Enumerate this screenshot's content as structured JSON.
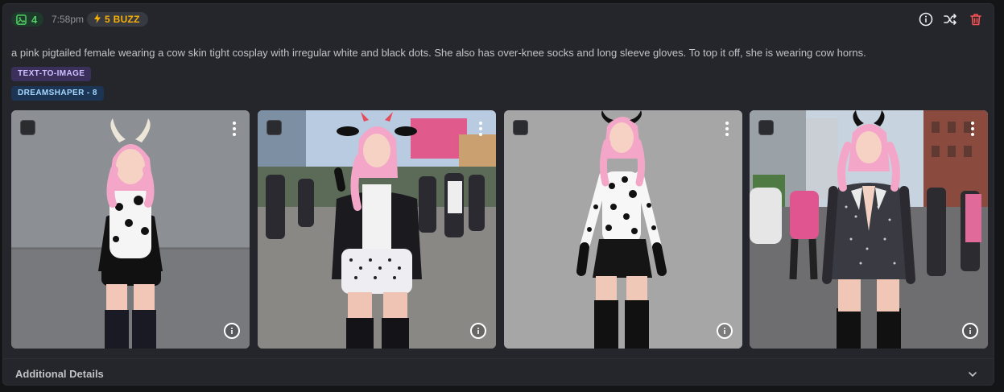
{
  "header": {
    "image_count": "4",
    "time": "7:58pm",
    "buzz": "5 BUZZ",
    "icons": [
      "image-icon",
      "bolt-icon",
      "info-circle-icon",
      "shuffle-icon",
      "trash-icon"
    ]
  },
  "prompt": "a pink pigtailed female wearing a cow skin tight cosplay with irregular white and black dots. She also has over-knee socks and long sleeve gloves. To top it off, she is wearing cow horns.",
  "tags": {
    "type": "TEXT-TO-IMAGE",
    "model": "DREAMSHAPER - 8"
  },
  "images": [
    {
      "scene": "grey wall studio",
      "checked": false
    },
    {
      "scene": "outdoor crowd",
      "checked": false
    },
    {
      "scene": "grey studio backdrop",
      "checked": false
    },
    {
      "scene": "city street crowd",
      "checked": false
    }
  ],
  "footer": {
    "label": "Additional Details"
  },
  "colors": {
    "background": "#141517",
    "card": "#25262b",
    "count_green": "#51cf66",
    "buzz_yellow": "#fab005",
    "delete_red": "#fa5252"
  }
}
